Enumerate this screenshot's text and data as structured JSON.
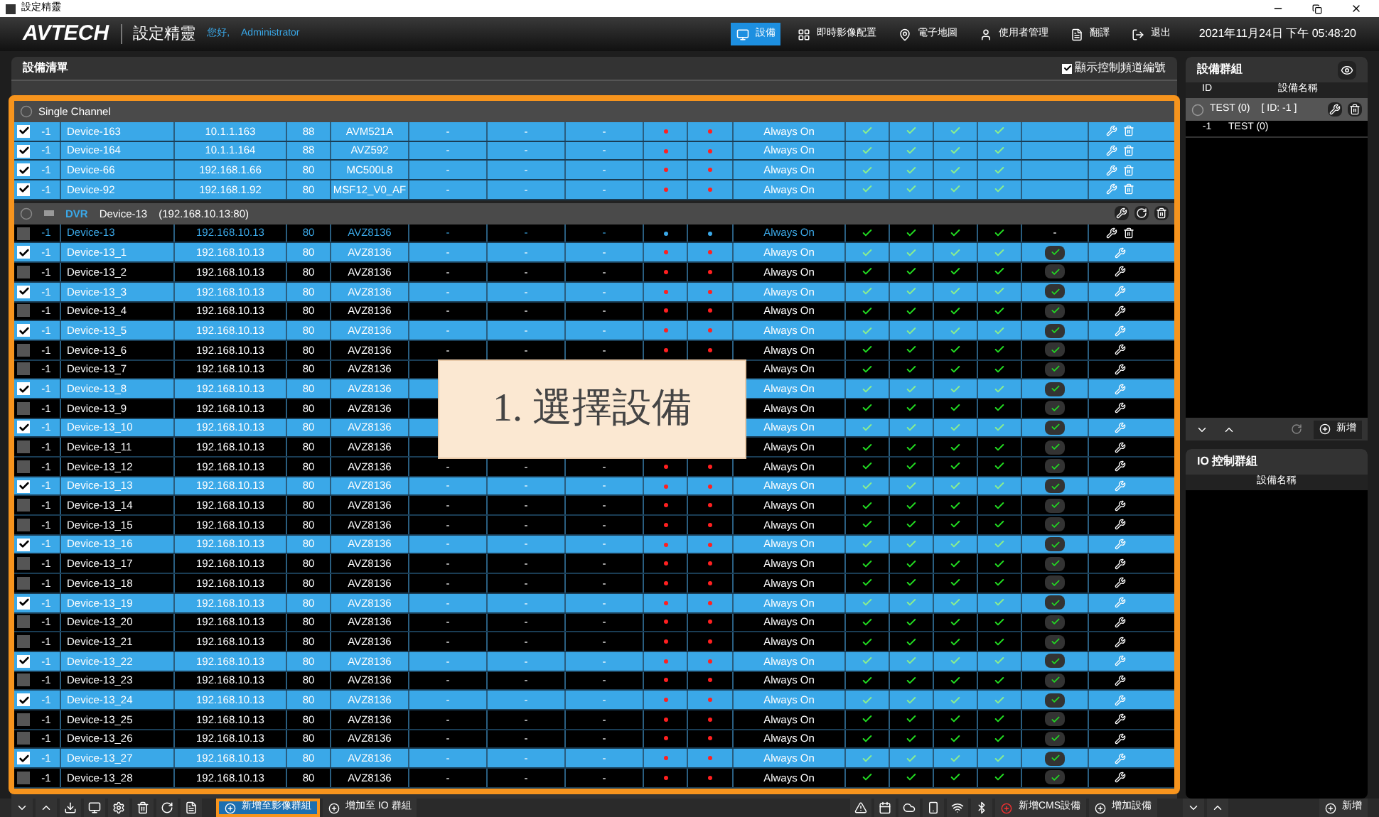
{
  "window": {
    "title": "設定精靈"
  },
  "header": {
    "logo": "AVTECH",
    "app_name": "設定精靈",
    "greeting": "您好,",
    "user": "Administrator",
    "nav": [
      {
        "label": "設備",
        "selected": true
      },
      {
        "label": "即時影像配置",
        "selected": false
      },
      {
        "label": "電子地圖",
        "selected": false
      },
      {
        "label": "使用者管理",
        "selected": false
      },
      {
        "label": "翻譯",
        "selected": false
      },
      {
        "label": "退出",
        "selected": false
      }
    ],
    "datetime": "2021年11月24日 下午 05:48:20"
  },
  "device_list": {
    "title": "設備清單",
    "show_channel_numbers": {
      "label": "顯示控制頻道編號",
      "checked": true
    },
    "groups": [
      {
        "kind": "single",
        "title": "Single Channel",
        "rows": [
          {
            "id": "-1",
            "name": "Device-163",
            "ip": "10.1.1.163",
            "port": "88",
            "model": "AVM521A",
            "cells": [
              "-",
              "-",
              "-"
            ],
            "schedule": "Always On",
            "rights": [
              true,
              true,
              true,
              true
            ],
            "selected": true
          },
          {
            "id": "-1",
            "name": "Device-164",
            "ip": "10.1.1.164",
            "port": "88",
            "model": "AVZ592",
            "cells": [
              "-",
              "-",
              "-"
            ],
            "schedule": "Always On",
            "rights": [
              true,
              true,
              true,
              true
            ],
            "selected": true
          },
          {
            "id": "-1",
            "name": "Device-66",
            "ip": "192.168.1.66",
            "port": "80",
            "model": "MC500L8",
            "cells": [
              "-",
              "-",
              "-"
            ],
            "schedule": "Always On",
            "rights": [
              true,
              true,
              true,
              true
            ],
            "selected": true
          },
          {
            "id": "-1",
            "name": "Device-92",
            "ip": "192.168.1.92",
            "port": "80",
            "model": "MSF12_V0_AF",
            "cells": [
              "-",
              "-",
              "-"
            ],
            "schedule": "Always On",
            "rights": [
              true,
              true,
              true,
              true
            ],
            "selected": true
          }
        ]
      },
      {
        "kind": "dvr",
        "type_label": "DVR",
        "title": "Device-13",
        "address": "(192.168.10.13:80)",
        "parent": {
          "id": "-1",
          "name": "Device-13",
          "ip": "192.168.10.13",
          "port": "80",
          "model": "AVZ8136",
          "cells": [
            "-",
            "-",
            "-"
          ],
          "schedule": "Always On",
          "rights": [
            true,
            true,
            true,
            true
          ],
          "talk": "-",
          "selected": false
        },
        "rows": [
          {
            "id": "-1",
            "name": "Device-13_1",
            "ip": "192.168.10.13",
            "port": "80",
            "model": "AVZ8136",
            "cells": [
              "-",
              "-",
              "-"
            ],
            "schedule": "Always On",
            "rights": [
              true,
              true,
              true,
              true
            ],
            "selected": true
          },
          {
            "id": "-1",
            "name": "Device-13_2",
            "ip": "192.168.10.13",
            "port": "80",
            "model": "AVZ8136",
            "cells": [
              "-",
              "-",
              "-"
            ],
            "schedule": "Always On",
            "rights": [
              true,
              true,
              true,
              true
            ],
            "selected": false
          },
          {
            "id": "-1",
            "name": "Device-13_3",
            "ip": "192.168.10.13",
            "port": "80",
            "model": "AVZ8136",
            "cells": [
              "-",
              "-",
              "-"
            ],
            "schedule": "Always On",
            "rights": [
              true,
              true,
              true,
              true
            ],
            "selected": true
          },
          {
            "id": "-1",
            "name": "Device-13_4",
            "ip": "192.168.10.13",
            "port": "80",
            "model": "AVZ8136",
            "cells": [
              "-",
              "-",
              "-"
            ],
            "schedule": "Always On",
            "rights": [
              true,
              true,
              true,
              true
            ],
            "selected": false
          },
          {
            "id": "-1",
            "name": "Device-13_5",
            "ip": "192.168.10.13",
            "port": "80",
            "model": "AVZ8136",
            "cells": [
              "-",
              "-",
              "-"
            ],
            "schedule": "Always On",
            "rights": [
              true,
              true,
              true,
              true
            ],
            "selected": true
          },
          {
            "id": "-1",
            "name": "Device-13_6",
            "ip": "192.168.10.13",
            "port": "80",
            "model": "AVZ8136",
            "cells": [
              "-",
              "-",
              "-"
            ],
            "schedule": "Always On",
            "rights": [
              true,
              true,
              true,
              true
            ],
            "selected": false
          },
          {
            "id": "-1",
            "name": "Device-13_7",
            "ip": "192.168.10.13",
            "port": "80",
            "model": "AVZ8136",
            "cells": [],
            "schedule": "Always On",
            "rights": [
              true,
              true,
              true,
              true
            ],
            "selected": false
          },
          {
            "id": "-1",
            "name": "Device-13_8",
            "ip": "192.168.10.13",
            "port": "80",
            "model": "AVZ8136",
            "cells": [],
            "schedule": "Always On",
            "rights": [
              true,
              true,
              true,
              true
            ],
            "selected": true
          },
          {
            "id": "-1",
            "name": "Device-13_9",
            "ip": "192.168.10.13",
            "port": "80",
            "model": "AVZ8136",
            "cells": [],
            "schedule": "Always On",
            "rights": [
              true,
              true,
              true,
              true
            ],
            "selected": false
          },
          {
            "id": "-1",
            "name": "Device-13_10",
            "ip": "192.168.10.13",
            "port": "80",
            "model": "AVZ8136",
            "cells": [],
            "schedule": "Always On",
            "rights": [
              true,
              true,
              true,
              true
            ],
            "selected": true
          },
          {
            "id": "-1",
            "name": "Device-13_11",
            "ip": "192.168.10.13",
            "port": "80",
            "model": "AVZ8136",
            "cells": [],
            "schedule": "Always On",
            "rights": [
              true,
              true,
              true,
              true
            ],
            "selected": false
          },
          {
            "id": "-1",
            "name": "Device-13_12",
            "ip": "192.168.10.13",
            "port": "80",
            "model": "AVZ8136",
            "cells": [
              "-",
              "-",
              "-"
            ],
            "schedule": "Always On",
            "rights": [
              true,
              true,
              true,
              true
            ],
            "selected": false
          },
          {
            "id": "-1",
            "name": "Device-13_13",
            "ip": "192.168.10.13",
            "port": "80",
            "model": "AVZ8136",
            "cells": [
              "-",
              "-",
              "-"
            ],
            "schedule": "Always On",
            "rights": [
              true,
              true,
              true,
              true
            ],
            "selected": true
          },
          {
            "id": "-1",
            "name": "Device-13_14",
            "ip": "192.168.10.13",
            "port": "80",
            "model": "AVZ8136",
            "cells": [
              "-",
              "-",
              "-"
            ],
            "schedule": "Always On",
            "rights": [
              true,
              true,
              true,
              true
            ],
            "selected": false
          },
          {
            "id": "-1",
            "name": "Device-13_15",
            "ip": "192.168.10.13",
            "port": "80",
            "model": "AVZ8136",
            "cells": [
              "-",
              "-",
              "-"
            ],
            "schedule": "Always On",
            "rights": [
              true,
              true,
              true,
              true
            ],
            "selected": false
          },
          {
            "id": "-1",
            "name": "Device-13_16",
            "ip": "192.168.10.13",
            "port": "80",
            "model": "AVZ8136",
            "cells": [
              "-",
              "-",
              "-"
            ],
            "schedule": "Always On",
            "rights": [
              true,
              true,
              true,
              true
            ],
            "selected": true
          },
          {
            "id": "-1",
            "name": "Device-13_17",
            "ip": "192.168.10.13",
            "port": "80",
            "model": "AVZ8136",
            "cells": [
              "-",
              "-",
              "-"
            ],
            "schedule": "Always On",
            "rights": [
              true,
              true,
              true,
              true
            ],
            "selected": false
          },
          {
            "id": "-1",
            "name": "Device-13_18",
            "ip": "192.168.10.13",
            "port": "80",
            "model": "AVZ8136",
            "cells": [
              "-",
              "-",
              "-"
            ],
            "schedule": "Always On",
            "rights": [
              true,
              true,
              true,
              true
            ],
            "selected": false
          },
          {
            "id": "-1",
            "name": "Device-13_19",
            "ip": "192.168.10.13",
            "port": "80",
            "model": "AVZ8136",
            "cells": [
              "-",
              "-",
              "-"
            ],
            "schedule": "Always On",
            "rights": [
              true,
              true,
              true,
              true
            ],
            "selected": true
          },
          {
            "id": "-1",
            "name": "Device-13_20",
            "ip": "192.168.10.13",
            "port": "80",
            "model": "AVZ8136",
            "cells": [
              "-",
              "-",
              "-"
            ],
            "schedule": "Always On",
            "rights": [
              true,
              true,
              true,
              true
            ],
            "selected": false
          },
          {
            "id": "-1",
            "name": "Device-13_21",
            "ip": "192.168.10.13",
            "port": "80",
            "model": "AVZ8136",
            "cells": [
              "-",
              "-",
              "-"
            ],
            "schedule": "Always On",
            "rights": [
              true,
              true,
              true,
              true
            ],
            "selected": false
          },
          {
            "id": "-1",
            "name": "Device-13_22",
            "ip": "192.168.10.13",
            "port": "80",
            "model": "AVZ8136",
            "cells": [
              "-",
              "-",
              "-"
            ],
            "schedule": "Always On",
            "rights": [
              true,
              true,
              true,
              true
            ],
            "selected": true
          },
          {
            "id": "-1",
            "name": "Device-13_23",
            "ip": "192.168.10.13",
            "port": "80",
            "model": "AVZ8136",
            "cells": [
              "-",
              "-",
              "-"
            ],
            "schedule": "Always On",
            "rights": [
              true,
              true,
              true,
              true
            ],
            "selected": false
          },
          {
            "id": "-1",
            "name": "Device-13_24",
            "ip": "192.168.10.13",
            "port": "80",
            "model": "AVZ8136",
            "cells": [
              "-",
              "-",
              "-"
            ],
            "schedule": "Always On",
            "rights": [
              true,
              true,
              true,
              true
            ],
            "selected": true
          },
          {
            "id": "-1",
            "name": "Device-13_25",
            "ip": "192.168.10.13",
            "port": "80",
            "model": "AVZ8136",
            "cells": [
              "-",
              "-",
              "-"
            ],
            "schedule": "Always On",
            "rights": [
              true,
              true,
              true,
              true
            ],
            "selected": false
          },
          {
            "id": "-1",
            "name": "Device-13_26",
            "ip": "192.168.10.13",
            "port": "80",
            "model": "AVZ8136",
            "cells": [
              "-",
              "-",
              "-"
            ],
            "schedule": "Always On",
            "rights": [
              true,
              true,
              true,
              true
            ],
            "selected": false
          },
          {
            "id": "-1",
            "name": "Device-13_27",
            "ip": "192.168.10.13",
            "port": "80",
            "model": "AVZ8136",
            "cells": [
              "-",
              "-",
              "-"
            ],
            "schedule": "Always On",
            "rights": [
              true,
              true,
              true,
              true
            ],
            "selected": true
          },
          {
            "id": "-1",
            "name": "Device-13_28",
            "ip": "192.168.10.13",
            "port": "80",
            "model": "AVZ8136",
            "cells": [
              "-",
              "-",
              "-"
            ],
            "schedule": "Always On",
            "rights": [
              true,
              true,
              true,
              true
            ],
            "selected": false
          }
        ]
      }
    ]
  },
  "callout": "1. 選擇設備",
  "device_groups": {
    "title": "設備群組",
    "columns": [
      "ID",
      "設備名稱"
    ],
    "group": {
      "title": "TEST (0)",
      "id_label": "[ ID: -1 ]",
      "rows": [
        {
          "id": "-1",
          "name": "TEST (0)"
        }
      ]
    },
    "add_button": "新增"
  },
  "io_groups": {
    "title": "IO 控制群組",
    "columns": [
      "設備名稱"
    ],
    "add_button": "新增"
  },
  "toolbar": {
    "add_to_video_group": "新增至影像群組",
    "add_to_io_group": "增加至 IO 群組",
    "add_cms": "新增CMS設備",
    "add_device": "增加設備"
  }
}
